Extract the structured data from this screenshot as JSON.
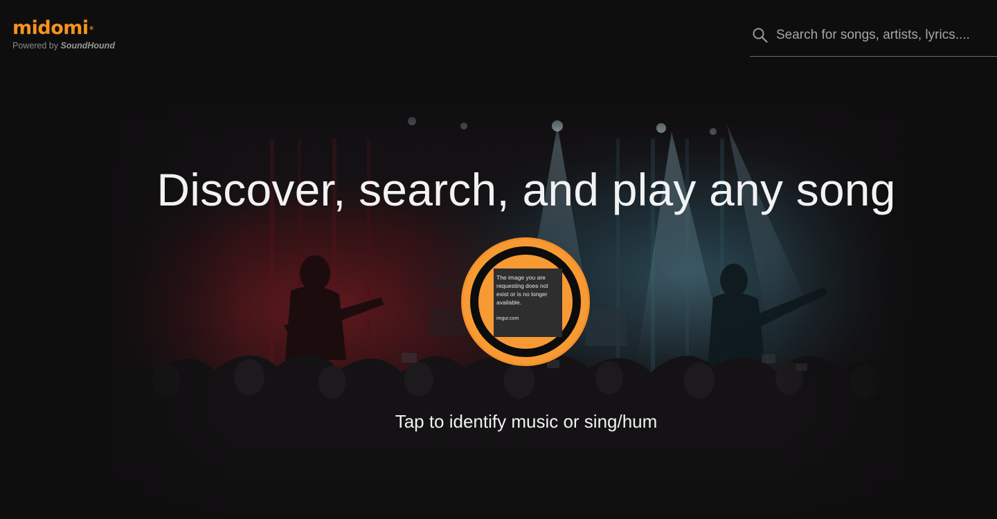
{
  "header": {
    "logo_text": "midomi",
    "logo_reg_mark": "®",
    "powered_by_label": "Powered by",
    "powered_by_brand": "SoundHound",
    "search_placeholder": "Search for songs, artists, lyrics....",
    "search_value": ""
  },
  "hero": {
    "headline": "Discover, search, and play any song",
    "listen_button": {
      "image_text": "The image you are requesting does not exist or is no longer available.",
      "image_site": "imgur.com"
    },
    "caption": "Tap to identify music or sing/hum"
  },
  "colors": {
    "brand_orange": "#f7931e",
    "button_orange": "#f89a33",
    "background": "#0f0e0f",
    "headline_text": "#f2f2f2"
  },
  "icons": {
    "search": "search-icon",
    "listen": "listen-button"
  }
}
